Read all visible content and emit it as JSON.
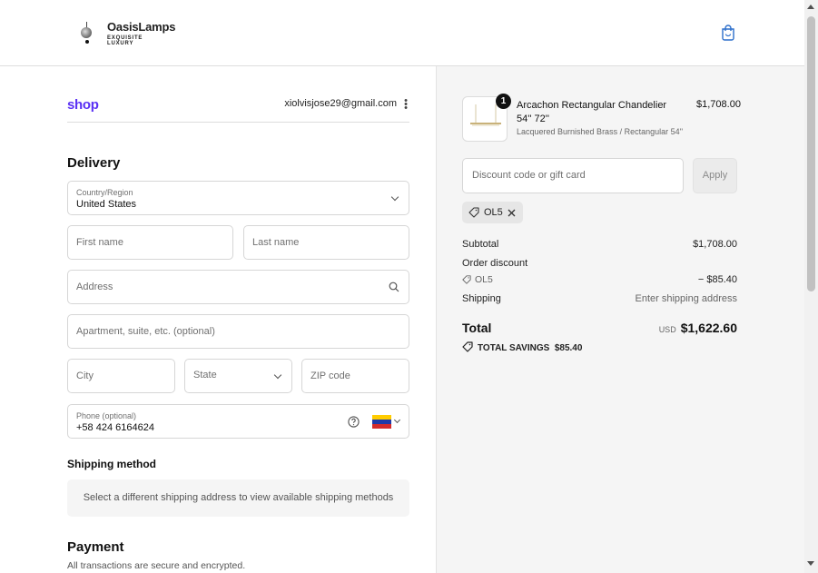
{
  "header": {
    "brand_name": "OasisLamps",
    "brand_tagline": "EXQUISITE LUXURY",
    "cart_icon": "shopping-bag-icon"
  },
  "account": {
    "shop_logo": "shop",
    "email": "xiolvisjose29@gmail.com",
    "menu_icon": "kebab-menu-icon"
  },
  "delivery": {
    "title": "Delivery",
    "country": {
      "label": "Country/Region",
      "value": "United States"
    },
    "first_name": {
      "placeholder": "First name"
    },
    "last_name": {
      "placeholder": "Last name"
    },
    "address": {
      "placeholder": "Address"
    },
    "apartment": {
      "placeholder": "Apartment, suite, etc. (optional)"
    },
    "city": {
      "placeholder": "City"
    },
    "state": {
      "placeholder": "State"
    },
    "zip": {
      "placeholder": "ZIP code"
    },
    "phone": {
      "label": "Phone (optional)",
      "value": "+58 424 6164624",
      "flag": "venezuela-flag-icon"
    }
  },
  "shipping_method": {
    "title": "Shipping method",
    "message": "Select a different shipping address to view available shipping methods"
  },
  "payment": {
    "title": "Payment",
    "subtitle": "All transactions are secure and encrypted."
  },
  "order": {
    "item": {
      "quantity": "1",
      "name": "Arcachon Rectangular Chandelier 54'' 72''",
      "variant": "Lacquered Burnished Brass / Rectangular 54''",
      "price": "$1,708.00"
    },
    "discount": {
      "placeholder": "Discount code or gift card",
      "apply_label": "Apply",
      "applied_code": "OL5"
    },
    "subtotal": {
      "label": "Subtotal",
      "value": "$1,708.00"
    },
    "order_discount": {
      "label": "Order discount",
      "code": "OL5",
      "value": "− $85.40"
    },
    "shipping": {
      "label": "Shipping",
      "value": "Enter shipping address"
    },
    "total": {
      "label": "Total",
      "currency": "USD",
      "value": "$1,622.60"
    },
    "savings": {
      "label": "TOTAL SAVINGS",
      "value": "$85.40"
    }
  },
  "colors": {
    "shop_purple": "#5a31f4",
    "panel_bg": "#f5f5f5",
    "border": "#d6d6d6"
  }
}
